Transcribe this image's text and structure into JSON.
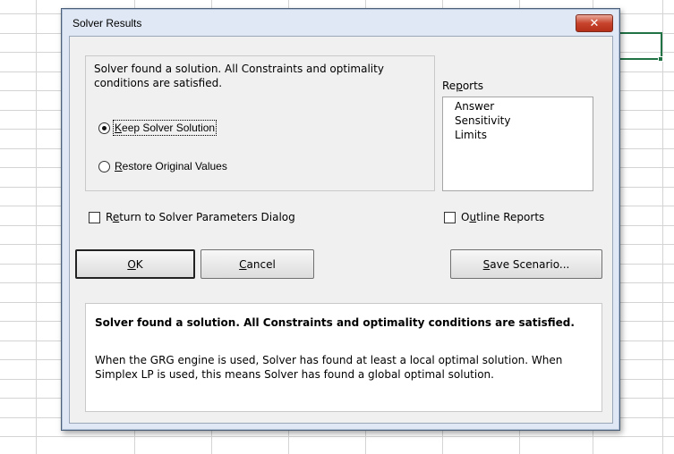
{
  "dialog": {
    "title": "Solver Results",
    "close_glyph": "✕",
    "message": "Solver found a solution.  All Constraints and optimality conditions are satisfied.",
    "options": {
      "keep": {
        "pre": "",
        "key": "K",
        "post": "eep Solver Solution",
        "checked": true
      },
      "restore": {
        "pre": "",
        "key": "R",
        "post": "estore Original Values",
        "checked": false
      }
    },
    "reports": {
      "label_pre": "Re",
      "label_key": "p",
      "label_post": "orts",
      "items": [
        "Answer",
        "Sensitivity",
        "Limits"
      ]
    },
    "return_check": {
      "pre": "R",
      "key": "e",
      "post": "turn to Solver Parameters Dialog",
      "checked": false
    },
    "outline_check": {
      "pre": "O",
      "key": "u",
      "post": "tline Reports",
      "checked": false
    },
    "buttons": {
      "ok": {
        "pre": "",
        "key": "O",
        "post": "K"
      },
      "cancel": {
        "pre": "",
        "key": "C",
        "post": "ancel"
      },
      "save": {
        "pre": "",
        "key": "S",
        "post": "ave Scenario..."
      }
    },
    "description": {
      "heading": "Solver found a solution.  All Constraints and optimality conditions are satisfied.",
      "body": "When the GRG engine is used, Solver has found at least a local optimal solution. When Simplex LP is used, this means Solver has found a global optimal solution."
    }
  },
  "colors": {
    "selection": "#217346",
    "close_button": "#c7432c",
    "dialog_frame": "#dfe8f4"
  }
}
